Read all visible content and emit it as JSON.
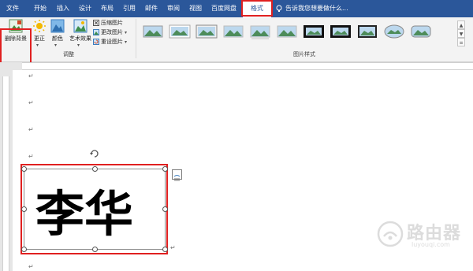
{
  "tabs": [
    "文件",
    "开始",
    "插入",
    "设计",
    "布局",
    "引用",
    "邮件",
    "审阅",
    "视图",
    "百度网盘",
    "格式"
  ],
  "active_tab": "格式",
  "tell_me": "告诉我您想要做什么...",
  "ribbon": {
    "remove_background": "删除背景",
    "corrections": "更正",
    "color": "颜色",
    "artistic_effects": "艺术效果",
    "compress_pictures": "压缩图片",
    "change_picture": "更改图片",
    "reset_picture": "重设图片",
    "adjust_group": "调整",
    "styles_group": "图片样式"
  },
  "document": {
    "para_mark": "↵",
    "image_text": "李华"
  },
  "watermark": {
    "brand": "路由器",
    "url": "luyouqi.com"
  },
  "colors": {
    "title_bar": "#2b579a",
    "highlight": "#e02020"
  }
}
